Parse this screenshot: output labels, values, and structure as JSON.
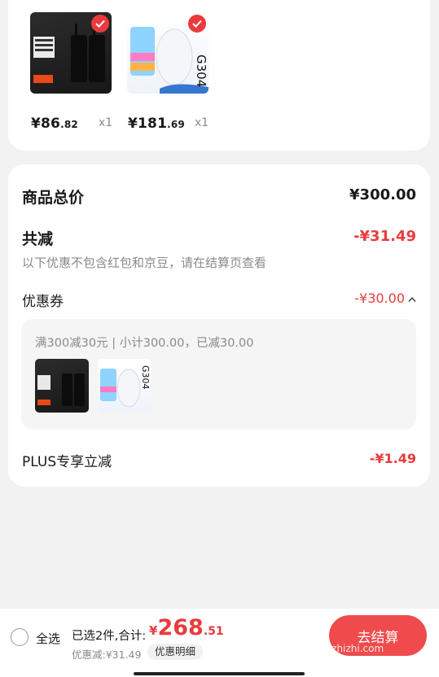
{
  "products": [
    {
      "price_int": "¥86",
      "price_dec": ".82",
      "qty": "x1",
      "image": "walkie-talkie-product"
    },
    {
      "price_int": "¥181",
      "price_dec": ".69",
      "qty": "x1",
      "image": "logitech-g304-mouse-product"
    }
  ],
  "summary": {
    "total_label": "商品总价",
    "total_value": "¥300.00",
    "reduce_label": "共减",
    "reduce_value": "-¥31.49",
    "note": "以下优惠不包含红包和京豆，请在结算页查看",
    "coupon_label": "优惠券",
    "coupon_value": "-¥30.00",
    "coupon_desc": "满300减30元 | 小计300.00，已减30.00",
    "plus_label": "PLUS专享立减",
    "plus_value": "-¥1.49"
  },
  "bottom_bar": {
    "select_all": "全选",
    "selected_info": "已选2件,合计:",
    "total_currency": "¥",
    "total_int": "268",
    "total_dec": ".51",
    "discount_info": "优惠减:¥31.49",
    "detail_button": "优惠明细",
    "checkout_button": "去结算",
    "watermark": "zhizhizhi.com"
  },
  "colors": {
    "accent": "#e93b3d",
    "background": "#f2f2f2"
  }
}
